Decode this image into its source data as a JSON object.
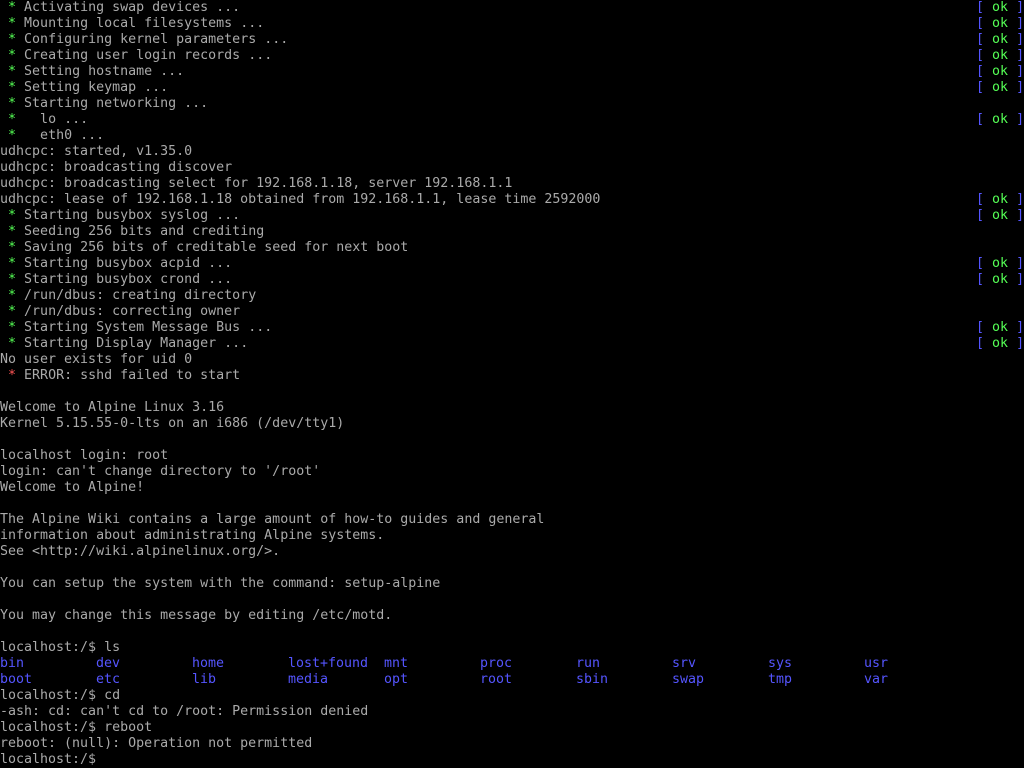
{
  "colors": {
    "background": "#000000",
    "text": "#aaaaaa",
    "star_ok": "#55ff55",
    "star_error": "#ff5555",
    "bracket": "#5555ff",
    "ok": "#55ff55",
    "directory": "#5555ff"
  },
  "lines": [
    {
      "kind": "svc",
      "text": "Activating swap devices ...",
      "status": "ok"
    },
    {
      "kind": "svc",
      "text": "Mounting local filesystems ...",
      "status": "ok"
    },
    {
      "kind": "svc",
      "text": "Configuring kernel parameters ...",
      "status": "ok"
    },
    {
      "kind": "svc",
      "text": "Creating user login records ...",
      "status": "ok"
    },
    {
      "kind": "svc",
      "text": "Setting hostname ...",
      "status": "ok"
    },
    {
      "kind": "svc",
      "text": "Setting keymap ...",
      "status": "ok"
    },
    {
      "kind": "svc",
      "text": "Starting networking ..."
    },
    {
      "kind": "svc",
      "text": "  lo ...",
      "status": "ok"
    },
    {
      "kind": "svc",
      "text": "  eth0 ..."
    },
    {
      "kind": "plain",
      "text": "udhcpc: started, v1.35.0"
    },
    {
      "kind": "plain",
      "text": "udhcpc: broadcasting discover"
    },
    {
      "kind": "plain",
      "text": "udhcpc: broadcasting select for 192.168.1.18, server 192.168.1.1"
    },
    {
      "kind": "plain",
      "text": "udhcpc: lease of 192.168.1.18 obtained from 192.168.1.1, lease time 2592000",
      "status": "ok"
    },
    {
      "kind": "svc",
      "text": "Starting busybox syslog ...",
      "status": "ok"
    },
    {
      "kind": "svc",
      "text": "Seeding 256 bits and crediting"
    },
    {
      "kind": "svc",
      "text": "Saving 256 bits of creditable seed for next boot"
    },
    {
      "kind": "svc",
      "text": "Starting busybox acpid ...",
      "status": "ok"
    },
    {
      "kind": "svc",
      "text": "Starting busybox crond ...",
      "status": "ok"
    },
    {
      "kind": "svc",
      "text": "/run/dbus: creating directory"
    },
    {
      "kind": "svc",
      "text": "/run/dbus: correcting owner"
    },
    {
      "kind": "svc",
      "text": "Starting System Message Bus ...",
      "status": "ok"
    },
    {
      "kind": "svc",
      "text": "Starting Display Manager ...",
      "status": "ok"
    },
    {
      "kind": "plain",
      "text": "No user exists for uid 0"
    },
    {
      "kind": "err",
      "text": "ERROR: sshd failed to start"
    },
    {
      "kind": "plain",
      "text": ""
    },
    {
      "kind": "plain",
      "text": "Welcome to Alpine Linux 3.16"
    },
    {
      "kind": "plain",
      "text": "Kernel 5.15.55-0-lts on an i686 (/dev/tty1)"
    },
    {
      "kind": "plain",
      "text": ""
    },
    {
      "kind": "plain",
      "text": "localhost login: root"
    },
    {
      "kind": "plain",
      "text": "login: can't change directory to '/root'"
    },
    {
      "kind": "plain",
      "text": "Welcome to Alpine!"
    },
    {
      "kind": "plain",
      "text": ""
    },
    {
      "kind": "plain",
      "text": "The Alpine Wiki contains a large amount of how-to guides and general"
    },
    {
      "kind": "plain",
      "text": "information about administrating Alpine systems."
    },
    {
      "kind": "plain",
      "text": "See <http://wiki.alpinelinux.org/>."
    },
    {
      "kind": "plain",
      "text": ""
    },
    {
      "kind": "plain",
      "text": "You can setup the system with the command: setup-alpine"
    },
    {
      "kind": "plain",
      "text": ""
    },
    {
      "kind": "plain",
      "text": "You may change this message by editing /etc/motd."
    },
    {
      "kind": "plain",
      "text": ""
    },
    {
      "kind": "prompt",
      "text": "localhost:/$ ls"
    },
    {
      "kind": "ls",
      "items": [
        "bin",
        "dev",
        "home",
        "lost+found",
        "mnt",
        "proc",
        "run",
        "srv",
        "sys",
        "usr"
      ]
    },
    {
      "kind": "ls",
      "items": [
        "boot",
        "etc",
        "lib",
        "media",
        "opt",
        "root",
        "sbin",
        "swap",
        "tmp",
        "var"
      ]
    },
    {
      "kind": "prompt",
      "text": "localhost:/$ cd"
    },
    {
      "kind": "plain",
      "text": "-ash: cd: can't cd to /root: Permission denied"
    },
    {
      "kind": "prompt",
      "text": "localhost:/$ reboot"
    },
    {
      "kind": "plain",
      "text": "reboot: (null): Operation not permitted"
    },
    {
      "kind": "prompt",
      "text": "localhost:/$ ",
      "active": true
    }
  ],
  "star_glyph": "*",
  "bracket_open": "[",
  "bracket_close": "]"
}
